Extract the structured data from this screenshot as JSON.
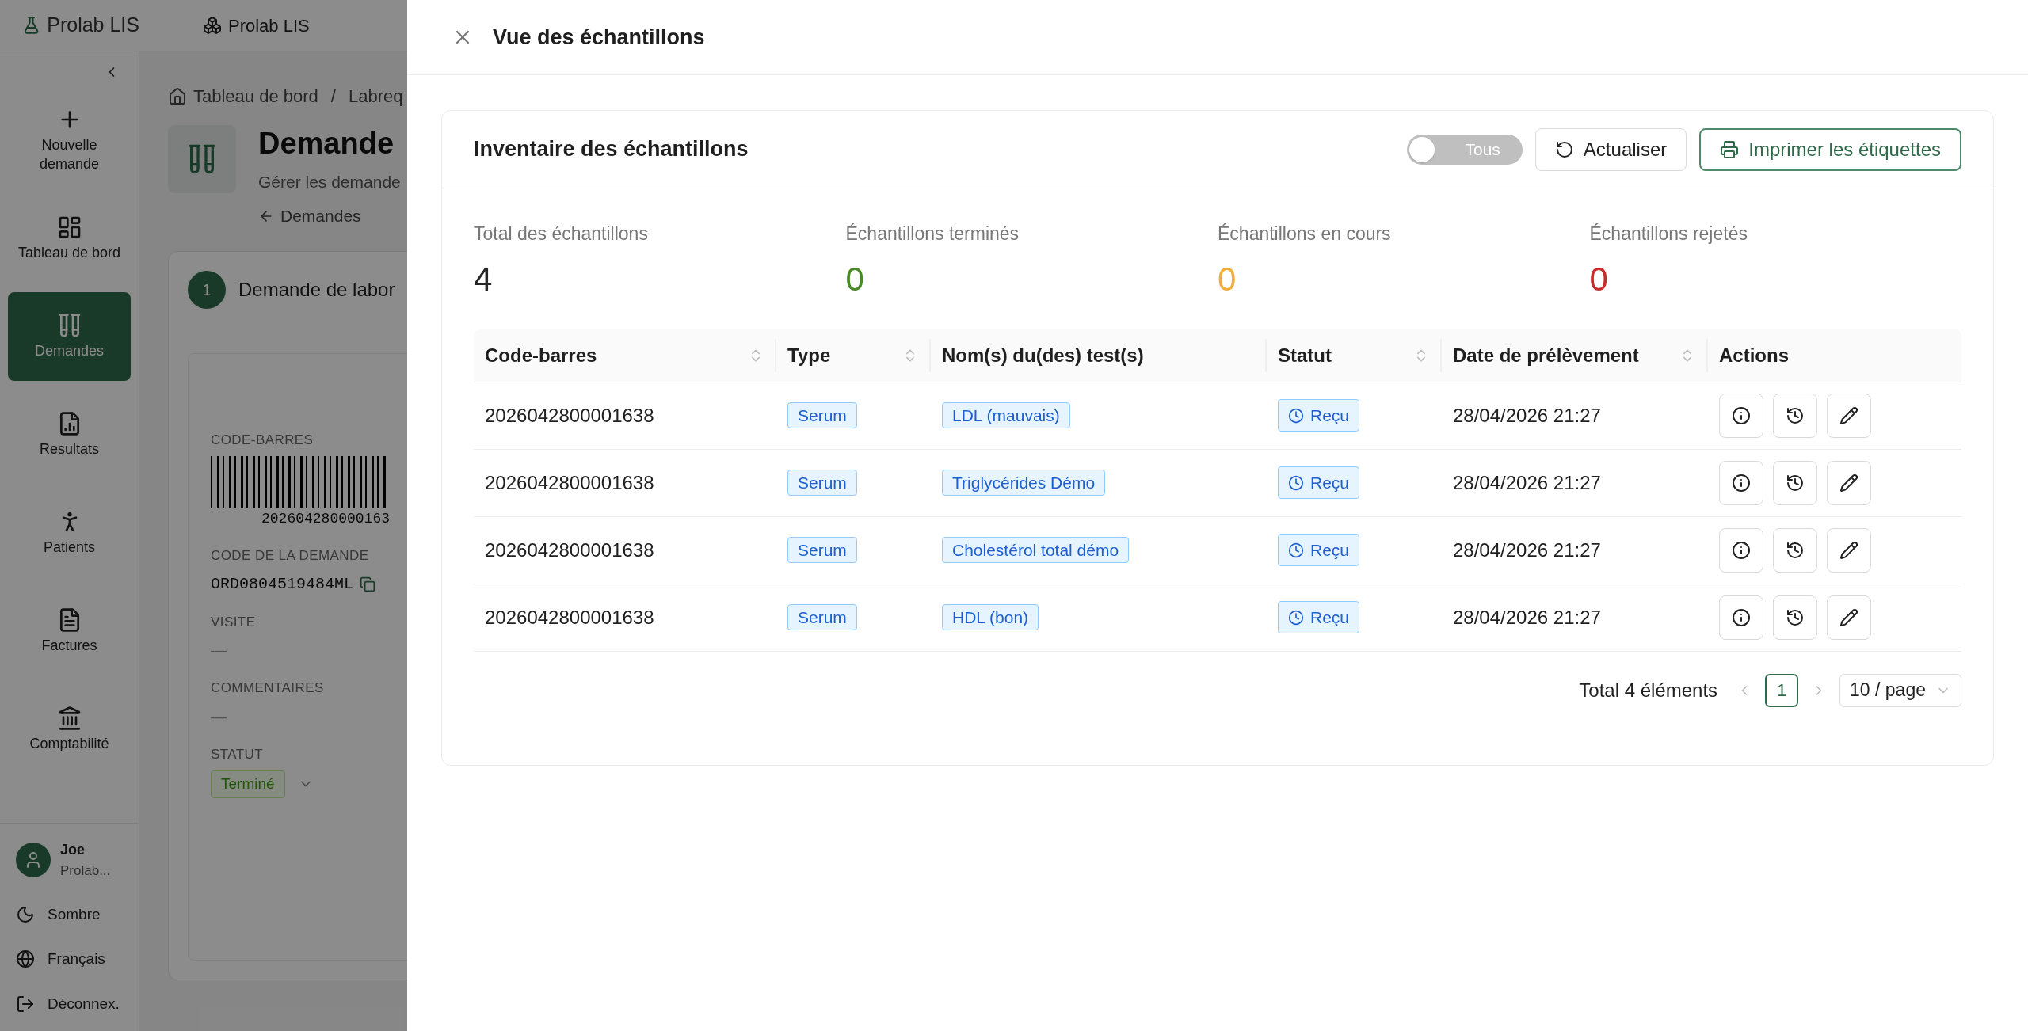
{
  "topbar": {
    "logo_text": "Prolab LIS",
    "org_name": "Prolab LIS"
  },
  "sidebar": {
    "items": [
      {
        "label": "Nouvelle demande",
        "selected": false
      },
      {
        "label": "Tableau de bord",
        "selected": false
      },
      {
        "label": "Demandes",
        "selected": true
      },
      {
        "label": "Resultats",
        "selected": false
      },
      {
        "label": "Patients",
        "selected": false
      },
      {
        "label": "Factures",
        "selected": false
      },
      {
        "label": "Comptabilité",
        "selected": false
      }
    ],
    "user": {
      "name": "Joe",
      "org": "Prolab..."
    },
    "footer_items": [
      "Sombre",
      "Français",
      "Déconnex."
    ]
  },
  "breadcrumb": {
    "separator": "/",
    "items": [
      "Tableau de bord",
      "Labreq"
    ]
  },
  "page": {
    "title": "Demande",
    "subtitle": "Gérer les demande",
    "back_link": "Demandes",
    "step": {
      "number": "1",
      "title": "Demande de labor"
    },
    "barcode": {
      "label": "CODE-BARRES",
      "number": "202604280000163"
    },
    "fields": [
      {
        "label": "CODE DE LA DEMANDE",
        "value": "ORD0804519484ML"
      },
      {
        "label": "VISITE",
        "value": "—"
      },
      {
        "label": "COMMENTAIRES",
        "value": "—"
      }
    ],
    "status": {
      "label": "STATUT",
      "value": "Terminé"
    }
  },
  "drawer": {
    "title": "Vue des échantillons",
    "card_title": "Inventaire des échantillons",
    "toggle": {
      "label": "Tous",
      "on": false
    },
    "refresh_button": "Actualiser",
    "print_button": "Imprimer les étiquettes",
    "stats": [
      {
        "label": "Total des échantillons",
        "value": "4",
        "color": "#262626"
      },
      {
        "label": "Échantillons terminés",
        "value": "0",
        "color": "#4b8a2a"
      },
      {
        "label": "Échantillons en cours",
        "value": "0",
        "color": "#f2ae3d"
      },
      {
        "label": "Échantillons rejetés",
        "value": "0",
        "color": "#c62d2d"
      }
    ],
    "table": {
      "columns": [
        {
          "label": "Code-barres",
          "sortable": true
        },
        {
          "label": "Type",
          "sortable": true
        },
        {
          "label": "Nom(s) du(des) test(s)",
          "sortable": false
        },
        {
          "label": "Statut",
          "sortable": true
        },
        {
          "label": "Date de prélèvement",
          "sortable": true
        },
        {
          "label": "Actions",
          "sortable": false
        }
      ],
      "rows": [
        {
          "barcode": "2026042800001638",
          "type": "Serum",
          "test": "LDL (mauvais)",
          "status": "Reçu",
          "date": "28/04/2026 21:27"
        },
        {
          "barcode": "2026042800001638",
          "type": "Serum",
          "test": "Triglycérides Démo",
          "status": "Reçu",
          "date": "28/04/2026 21:27"
        },
        {
          "barcode": "2026042800001638",
          "type": "Serum",
          "test": "Cholestérol total démo",
          "status": "Reçu",
          "date": "28/04/2026 21:27"
        },
        {
          "barcode": "2026042800001638",
          "type": "Serum",
          "test": "HDL (bon)",
          "status": "Reçu",
          "date": "28/04/2026 21:27"
        }
      ]
    },
    "pagination": {
      "total": "Total 4 éléments",
      "pages": [
        {
          "label": "1",
          "selected": true
        }
      ],
      "page_size": "10 / page"
    }
  }
}
